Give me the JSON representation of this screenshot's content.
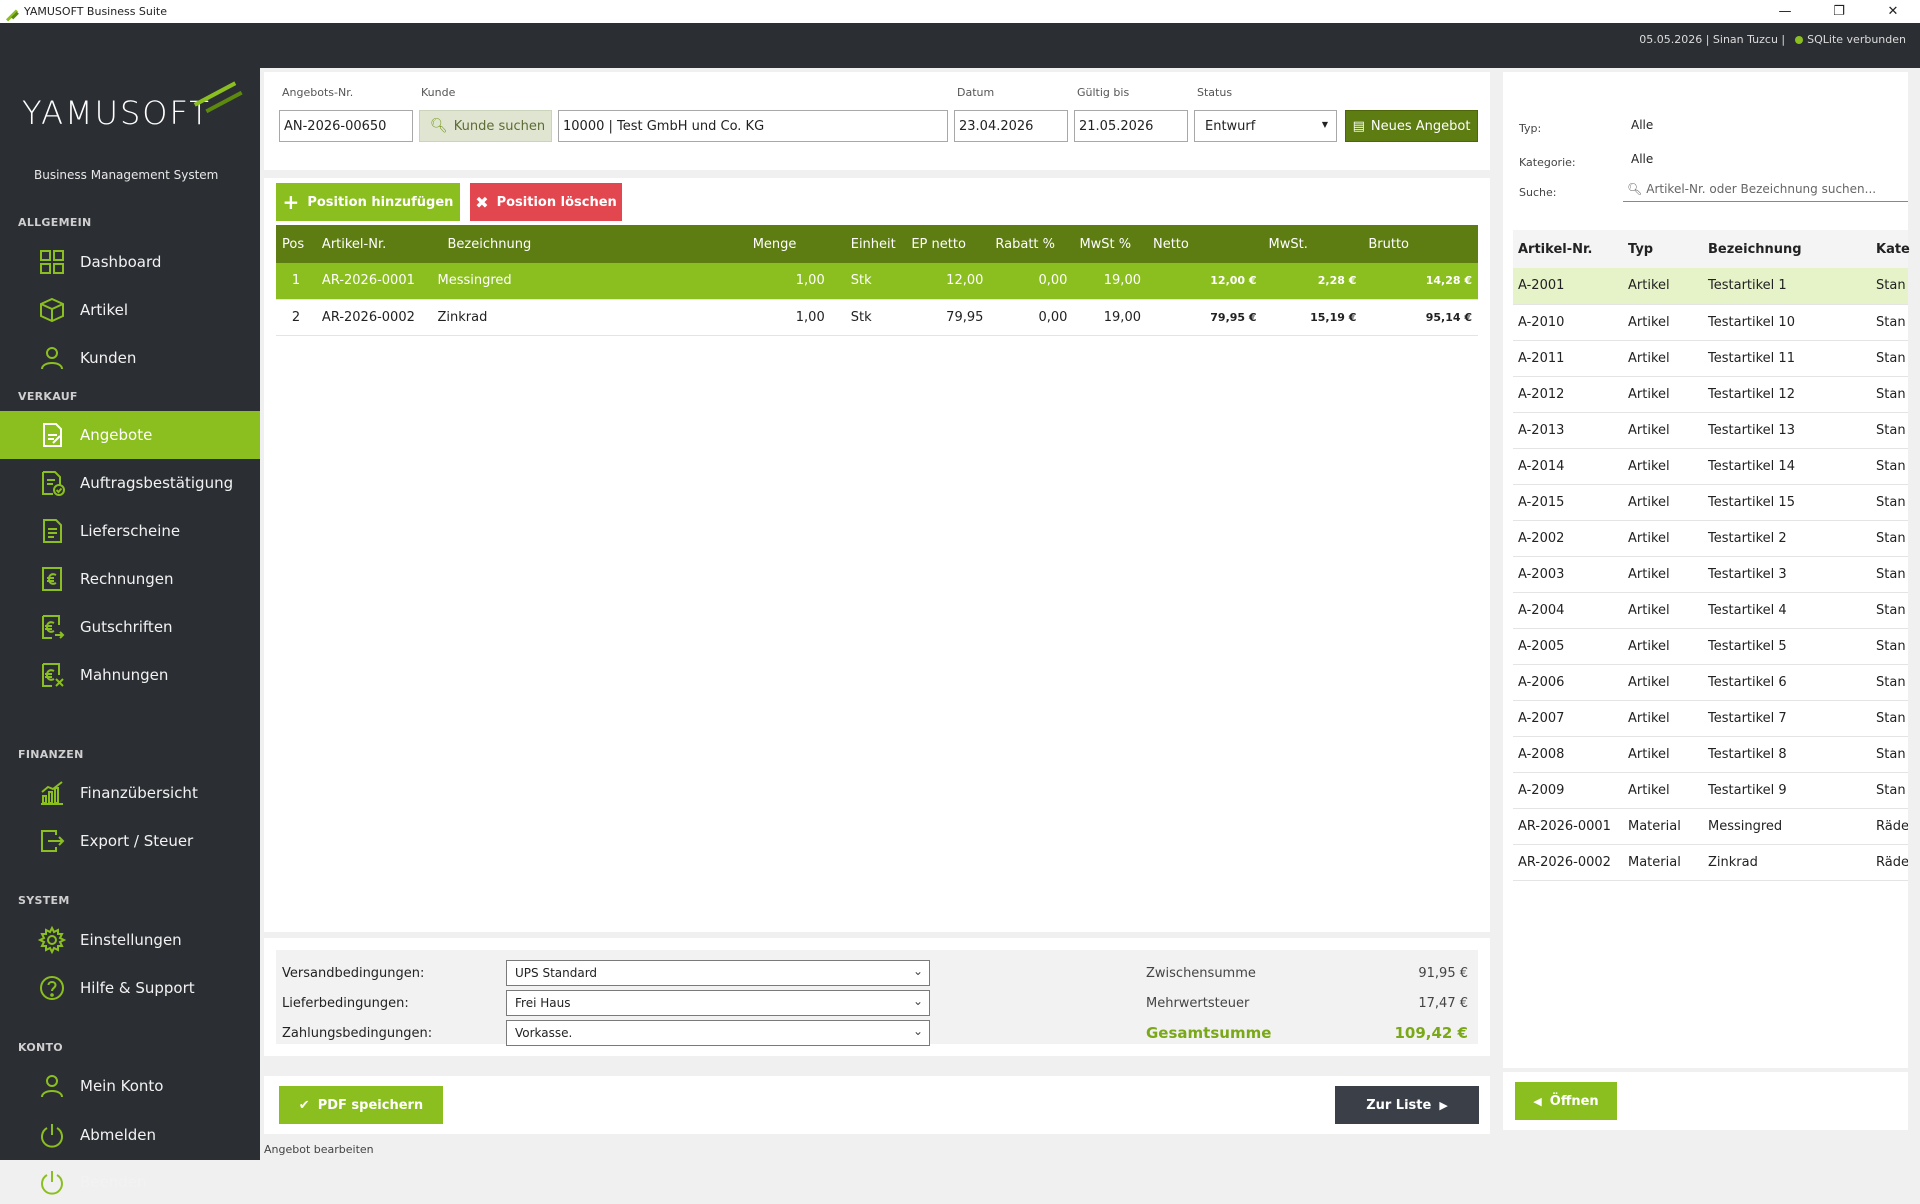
{
  "app": {
    "window_title": "YAMUSOFT Business Suite",
    "brand": "YAMUSOFT",
    "tagline": "Business Management System",
    "header_info": "05.05.2026 | Sinan Tuzcu |",
    "db_status": "SQLite verbunden"
  },
  "colors": {
    "accent": "#8bbf1f",
    "dark_accent": "#5d7c11",
    "sidebar": "#2b2e33",
    "danger": "#e2474f"
  },
  "sidebar": {
    "sections": [
      "ALLGEMEIN",
      "VERKAUF",
      "FINANZEN",
      "SYSTEM",
      "KONTO"
    ],
    "items": [
      {
        "label": "Dashboard",
        "icon": "grid-icon"
      },
      {
        "label": "Artikel",
        "icon": "box-icon"
      },
      {
        "label": "Kunden",
        "icon": "user-icon"
      },
      {
        "label": "Angebote",
        "icon": "document-edit-icon",
        "active": true
      },
      {
        "label": "Auftragsbestätigung",
        "icon": "document-check-icon"
      },
      {
        "label": "Lieferscheine",
        "icon": "document-icon"
      },
      {
        "label": "Rechnungen",
        "icon": "euro-document-icon"
      },
      {
        "label": "Gutschriften",
        "icon": "euro-return-icon"
      },
      {
        "label": "Mahnungen",
        "icon": "euro-warning-icon"
      },
      {
        "label": "Finanzübersicht",
        "icon": "bar-chart-icon"
      },
      {
        "label": "Export / Steuer",
        "icon": "export-icon"
      },
      {
        "label": "Einstellungen",
        "icon": "gear-icon"
      },
      {
        "label": "Hilfe & Support",
        "icon": "help-icon"
      },
      {
        "label": "Mein Konto",
        "icon": "user-icon"
      },
      {
        "label": "Abmelden",
        "icon": "power-icon"
      },
      {
        "label": "Beenden",
        "icon": "power-icon"
      }
    ]
  },
  "form": {
    "angebot_nr_label": "Angebots-Nr.",
    "angebot_nr": "AN-2026-00650",
    "kunde_label": "Kunde",
    "kunde_search_button": "Kunde suchen",
    "kunde_value": "10000 | Test GmbH und Co. KG",
    "datum_label": "Datum",
    "datum": "23.04.2026",
    "gueltig_label": "Gültig bis",
    "gueltig": "21.05.2026",
    "status_label": "Status",
    "status": "Entwurf",
    "new_button": "Neues Angebot"
  },
  "positions": {
    "add_button": "Position hinzufügen",
    "delete_button": "Position löschen",
    "columns": [
      "Pos",
      "Artikel-Nr.",
      "Bezeichnung",
      "Menge",
      "Einheit",
      "EP netto",
      "Rabatt %",
      "MwSt %",
      "Netto",
      "MwSt.",
      "Brutto"
    ],
    "rows": [
      [
        "1",
        "AR-2026-0001",
        "Messingred",
        "1,00",
        "Stk",
        "12,00",
        "0,00",
        "19,00",
        "12,00 €",
        "2,28 €",
        "14,28 €"
      ],
      [
        "2",
        "AR-2026-0002",
        "Zinkrad",
        "1,00",
        "Stk",
        "79,95",
        "0,00",
        "19,00",
        "79,95 €",
        "15,19 €",
        "95,14 €"
      ]
    ]
  },
  "conditions": {
    "versand_label": "Versandbedingungen:",
    "versand": "UPS Standard",
    "liefer_label": "Lieferbedingungen:",
    "liefer": "Frei Haus",
    "zahlung_label": "Zahlungsbedingungen:",
    "zahlung": "Vorkasse."
  },
  "totals": {
    "zwischen_label": "Zwischensumme",
    "zwischen": "91,95 €",
    "mwst_label": "Mehrwertsteuer",
    "mwst": "17,47 €",
    "gesamt_label": "Gesamtsumme",
    "gesamt": "109,42 €"
  },
  "footer": {
    "pdf_button": "PDF speichern",
    "list_button": "Zur Liste",
    "open_button": "Öffnen",
    "status_text": "Angebot bearbeiten"
  },
  "filter": {
    "typ_label": "Typ:",
    "typ": "Alle",
    "kategorie_label": "Kategorie:",
    "kategorie": "Alle",
    "suche_label": "Suche:",
    "suche_placeholder": "Artikel-Nr. oder Bezeichnung suchen..."
  },
  "articles": {
    "columns": [
      "Artikel-Nr.",
      "Typ",
      "Bezeichnung",
      "Kate"
    ],
    "rows": [
      [
        "A-2001",
        "Artikel",
        "Testartikel 1",
        "Stan"
      ],
      [
        "A-2010",
        "Artikel",
        "Testartikel 10",
        "Stan"
      ],
      [
        "A-2011",
        "Artikel",
        "Testartikel 11",
        "Stan"
      ],
      [
        "A-2012",
        "Artikel",
        "Testartikel 12",
        "Stan"
      ],
      [
        "A-2013",
        "Artikel",
        "Testartikel 13",
        "Stan"
      ],
      [
        "A-2014",
        "Artikel",
        "Testartikel 14",
        "Stan"
      ],
      [
        "A-2015",
        "Artikel",
        "Testartikel 15",
        "Stan"
      ],
      [
        "A-2002",
        "Artikel",
        "Testartikel 2",
        "Stan"
      ],
      [
        "A-2003",
        "Artikel",
        "Testartikel 3",
        "Stan"
      ],
      [
        "A-2004",
        "Artikel",
        "Testartikel 4",
        "Stan"
      ],
      [
        "A-2005",
        "Artikel",
        "Testartikel 5",
        "Stan"
      ],
      [
        "A-2006",
        "Artikel",
        "Testartikel 6",
        "Stan"
      ],
      [
        "A-2007",
        "Artikel",
        "Testartikel 7",
        "Stan"
      ],
      [
        "A-2008",
        "Artikel",
        "Testartikel 8",
        "Stan"
      ],
      [
        "A-2009",
        "Artikel",
        "Testartikel 9",
        "Stan"
      ],
      [
        "AR-2026-0001",
        "Material",
        "Messingred",
        "Räde"
      ],
      [
        "AR-2026-0002",
        "Material",
        "Zinkrad",
        "Räde"
      ]
    ]
  }
}
